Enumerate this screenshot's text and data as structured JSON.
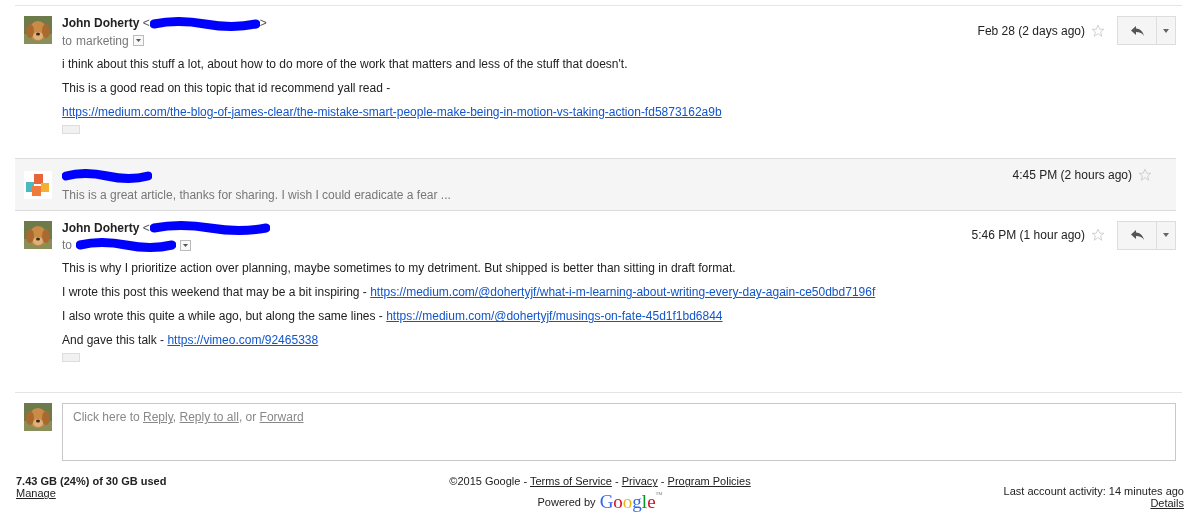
{
  "messages": [
    {
      "kind": "expanded",
      "sender": "John Doherty",
      "email_open": "<",
      "email_close": ">",
      "email_redacted": true,
      "recipient_prefix": "to",
      "recipient": "marketing",
      "recipient_redacted": false,
      "date": "Feb 28 (2 days ago)",
      "starred": false,
      "paragraphs": [
        [
          {
            "text": "i think about this stuff a lot, about how to do more of the work that matters and less of the stuff that doesn't."
          }
        ],
        [
          {
            "text": "This is a good read on this topic that id recommend yall read -"
          }
        ],
        [
          {
            "link": "https://medium.com/the-blog-of-james-clear/the-mistake-smart-people-make-being-in-motion-vs-taking-action-fd5873162a9b"
          }
        ]
      ]
    },
    {
      "kind": "collapsed",
      "sender_redacted": true,
      "snippet": "This is a great article, thanks for sharing. I wish I could eradicate a fear ...",
      "date": "4:45 PM (2 hours ago)",
      "starred": false
    },
    {
      "kind": "expanded",
      "sender": "John Doherty",
      "email_open": "<",
      "email_redacted": true,
      "recipient_prefix": "to",
      "recipient_redacted": true,
      "date": "5:46 PM (1 hour ago)",
      "starred": false,
      "paragraphs": [
        [
          {
            "text": "This is why I prioritize action over planning, maybe sometimes to my detriment. But shipped is better than sitting in draft format."
          }
        ],
        [
          {
            "text": "I wrote this post this weekend that may be a bit inspiring - "
          },
          {
            "link": "https://medium.com/@dohertyjf/what-i-m-learning-about-writing-every-day-again-ce50dbd7196f"
          }
        ],
        [
          {
            "text": "I also wrote this quite a while ago, but along the same lines - "
          },
          {
            "link": "https://medium.com/@dohertyjf/musings-on-fate-45d1f1bd6844"
          }
        ],
        [
          {
            "text": "And gave this talk - "
          },
          {
            "link": "https://vimeo.com/92465338"
          }
        ]
      ]
    }
  ],
  "reply_box": {
    "prefix": "Click here to ",
    "reply": "Reply",
    "sep1": ", ",
    "reply_all": "Reply to all",
    "sep2": ", or ",
    "forward": "Forward"
  },
  "footer": {
    "storage": "7.43 GB (24%) of 30 GB used",
    "manage": "Manage",
    "copyright": "©2015 Google - ",
    "terms": "Terms of Service",
    "privacy": "Privacy",
    "policies": "Program Policies",
    "dash": " - ",
    "powered_by": "Powered by",
    "logo": "Google",
    "tm": "™",
    "activity": "Last account activity: 14 minutes ago",
    "details": "Details"
  }
}
